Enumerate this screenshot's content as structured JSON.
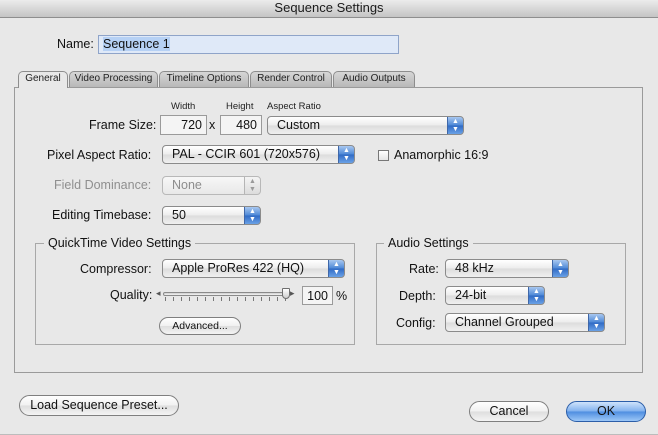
{
  "window": {
    "title": "Sequence Settings"
  },
  "name_field": {
    "label": "Name:",
    "value": "Sequence 1"
  },
  "tabs": [
    {
      "label": "General",
      "active": true
    },
    {
      "label": "Video Processing",
      "active": false
    },
    {
      "label": "Timeline Options",
      "active": false
    },
    {
      "label": "Render Control",
      "active": false
    },
    {
      "label": "Audio Outputs",
      "active": false
    }
  ],
  "general": {
    "frame_size": {
      "label": "Frame Size:",
      "width_header": "Width",
      "height_header": "Height",
      "aspect_header": "Aspect Ratio",
      "width": "720",
      "x": "x",
      "height": "480",
      "aspect_ratio": "Custom"
    },
    "pixel_aspect": {
      "label": "Pixel Aspect Ratio:",
      "value": "PAL - CCIR 601 (720x576)"
    },
    "anamorphic": {
      "label": "Anamorphic 16:9",
      "checked": false
    },
    "field_dominance": {
      "label": "Field Dominance:",
      "value": "None",
      "enabled": false
    },
    "editing_timebase": {
      "label": "Editing Timebase:",
      "value": "50"
    }
  },
  "quicktime": {
    "title": "QuickTime Video Settings",
    "compressor_label": "Compressor:",
    "compressor": "Apple ProRes 422 (HQ)",
    "quality_label": "Quality:",
    "quality_value": "100",
    "quality_unit": "%",
    "quality_fraction": 1.0,
    "advanced_button": "Advanced..."
  },
  "audio": {
    "title": "Audio Settings",
    "rate_label": "Rate:",
    "rate": "48 kHz",
    "depth_label": "Depth:",
    "depth": "24-bit",
    "config_label": "Config:",
    "config": "Channel Grouped"
  },
  "footer": {
    "load_preset_button": "Load Sequence Preset...",
    "cancel_button": "Cancel",
    "ok_button": "OK"
  },
  "colors": {
    "accent": "#4d8de0",
    "selection": "#b6d1f5"
  }
}
